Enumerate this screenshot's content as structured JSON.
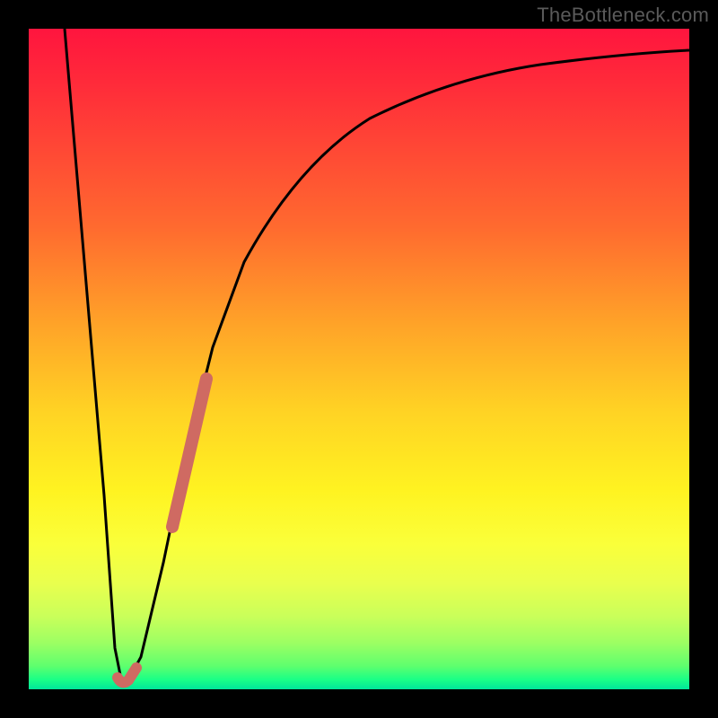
{
  "watermark": "TheBottleneck.com",
  "colors": {
    "frame": "#000000",
    "curve": "#000000",
    "highlight": "#cf6a62"
  },
  "chart_data": {
    "type": "line",
    "title": "",
    "xlabel": "",
    "ylabel": "",
    "xlim": [
      0,
      100
    ],
    "ylim": [
      0,
      100
    ],
    "grid": false,
    "legend": false,
    "series": [
      {
        "name": "bottleneck-curve",
        "x": [
          5,
          10,
          12,
          14,
          16,
          18,
          20,
          22,
          25,
          28,
          32,
          36,
          40,
          45,
          50,
          55,
          60,
          70,
          80,
          90,
          100
        ],
        "y": [
          100,
          40,
          10,
          1,
          3,
          12,
          26,
          38,
          52,
          62,
          71,
          77,
          81,
          85,
          88,
          90,
          91.5,
          93.5,
          94.5,
          95.3,
          96
        ]
      }
    ],
    "highlight_segments": [
      {
        "name": "dip-marker",
        "x": [
          13,
          14,
          15
        ],
        "y": [
          1.5,
          1,
          2
        ]
      },
      {
        "name": "rising-marker",
        "x": [
          22,
          23,
          24,
          25,
          26
        ],
        "y": [
          38,
          44,
          49,
          53,
          57
        ]
      }
    ]
  }
}
